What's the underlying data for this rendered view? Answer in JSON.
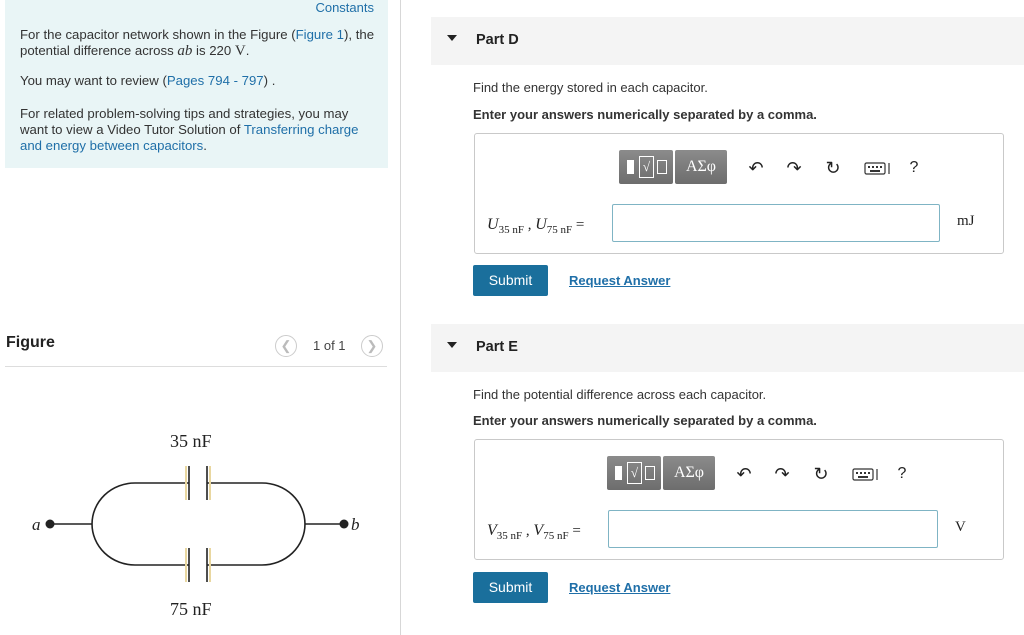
{
  "intro": {
    "constants_label": "Constants",
    "p1_before": "For the capacitor network shown in the Figure (",
    "p1_figure_link": "Figure 1",
    "p1_after": "), the potential difference across ",
    "p1_var": "ab",
    "p1_is": " is 220 ",
    "p1_unit": "V",
    "p1_end": ".",
    "p2_before": "You may want to review (",
    "p2_link": "Pages 794 - 797",
    "p2_after": ") .",
    "p3_before": "For related problem-solving tips and strategies, you may want to view a Video Tutor Solution of ",
    "p3_link": "Transferring charge and energy between capacitors",
    "p3_after": "."
  },
  "figure": {
    "title": "Figure",
    "pager": "1 of 1",
    "prev_icon": "chevron-left-icon",
    "next_icon": "chevron-right-icon",
    "cap_top_label": "35 nF",
    "cap_bottom_label": "75 nF",
    "node_a": "a",
    "node_b": "b"
  },
  "parts": [
    {
      "title": "Part D",
      "prompt": "Find the energy stored in each capacitor.",
      "instruction": "Enter your answers numerically separated by a comma.",
      "var1": "U",
      "sub1": "35 nF",
      "var2": "U",
      "sub2": "75 nF",
      "equals": "=",
      "input_value": "",
      "unit": "mJ",
      "submit_label": "Submit",
      "request_label": "Request Answer"
    },
    {
      "title": "Part E",
      "prompt": "Find the potential difference across each capacitor.",
      "instruction": "Enter your answers numerically separated by a comma.",
      "var1": "V",
      "sub1": "35 nF",
      "var2": "V",
      "sub2": "75 nF",
      "equals": "=",
      "input_value": "",
      "unit": "V",
      "submit_label": "Submit",
      "request_label": "Request Answer"
    }
  ],
  "toolbar": {
    "greek_label": "ΑΣφ",
    "templates_glyph": "√",
    "undo_glyph": "↶",
    "redo_glyph": "↷",
    "reset_glyph": "↻",
    "help_label": "?"
  }
}
